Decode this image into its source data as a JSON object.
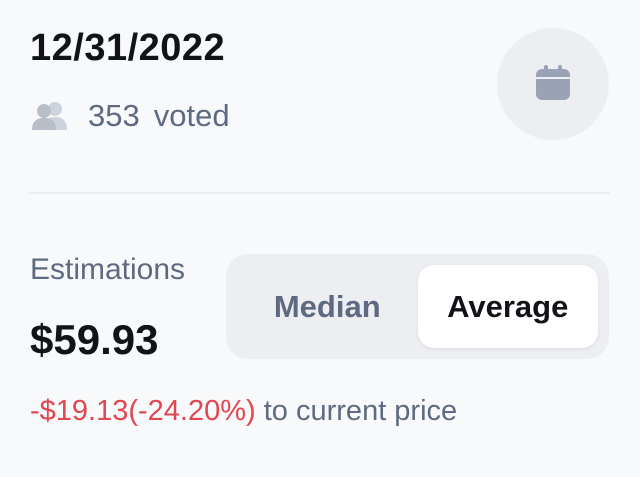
{
  "header": {
    "date": "12/31/2022",
    "vote_count": "353",
    "vote_suffix": "voted"
  },
  "icons": {
    "people": "people-icon",
    "calendar": "calendar-icon"
  },
  "estimations": {
    "label": "Estimations",
    "value": "$59.93",
    "toggle": {
      "options": [
        "Median",
        "Average"
      ],
      "selected": "Average"
    },
    "change_amount": "-$19.13",
    "change_percent": "(-24.20%)",
    "change_suffix": "to current price"
  },
  "colors": {
    "negative": "#e0474f",
    "muted": "#5e6a82",
    "primary_text": "#111318"
  }
}
